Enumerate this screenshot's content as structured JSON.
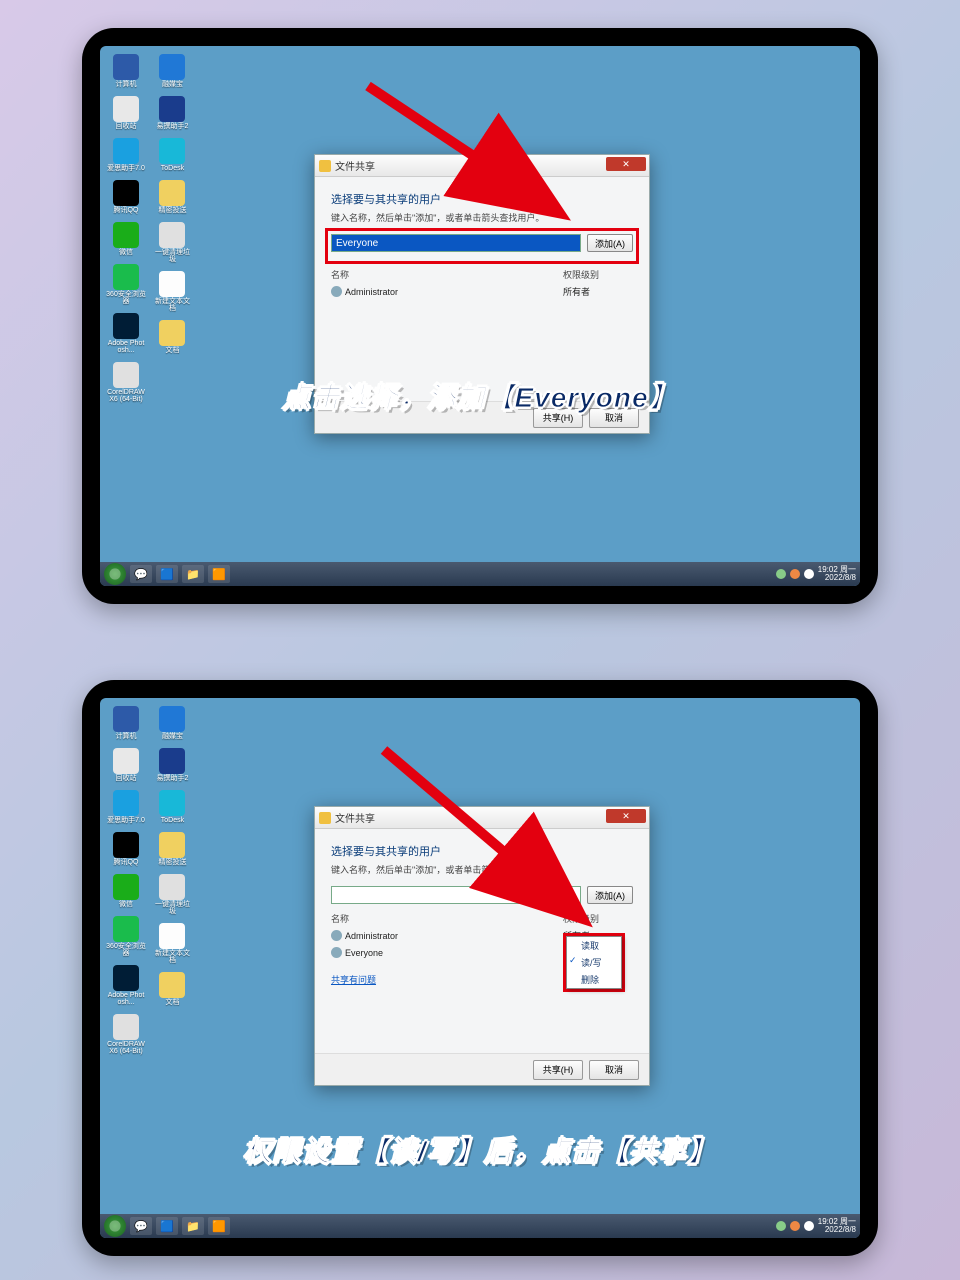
{
  "desktop_icons_col1": [
    {
      "label": "计算机",
      "bg": "#2d5aa8"
    },
    {
      "label": "回收站",
      "bg": "#e8e8e8"
    },
    {
      "label": "爱思助手7.0",
      "bg": "#1aa0e0"
    },
    {
      "label": "腾讯QQ",
      "bg": "#000"
    },
    {
      "label": "微信",
      "bg": "#1aad19"
    },
    {
      "label": "360安全浏览器",
      "bg": "#1abc4c"
    },
    {
      "label": "Adobe Photosh...",
      "bg": "#001d36"
    },
    {
      "label": "CorelDRAW X6 (64-Bit)",
      "bg": "#e0e0e0"
    }
  ],
  "desktop_icons_col2": [
    {
      "label": "融媒宝",
      "bg": "#2078d6"
    },
    {
      "label": "易撰助手2",
      "bg": "#1a3c8c"
    },
    {
      "label": "ToDesk",
      "bg": "#18b8d8"
    },
    {
      "label": "精密投送",
      "bg": "#f0d060"
    },
    {
      "label": "一键清理垃圾",
      "bg": "#e0e0e0"
    },
    {
      "label": "新建文本文档",
      "bg": "#fdfdfd"
    },
    {
      "label": "文档",
      "bg": "#f0d060"
    }
  ],
  "dialog": {
    "title": "文件共享",
    "subtitle": "选择要与其共享的用户",
    "hint": "键入名称，然后单击\"添加\"，或者单击箭头查找用户。",
    "combo_value": "Everyone",
    "add_btn": "添加(A)",
    "col_name": "名称",
    "col_perm": "权限级别",
    "rows1": [
      {
        "name": "Administrator",
        "perm": "所有者"
      }
    ],
    "rows2": [
      {
        "name": "Administrator",
        "perm": "所有者"
      },
      {
        "name": "Everyone",
        "perm": "读取/写入 ▼"
      }
    ],
    "perm_menu": [
      "读取",
      "读/写",
      "删除"
    ],
    "link": "共享有问题",
    "share_btn": "共享(H)",
    "cancel_btn": "取消"
  },
  "captions": {
    "top": "点击选择，添加【Everyone】",
    "bottom": "权限设置【读/写】后，点击【共享】"
  },
  "taskbar": {
    "time": "19:02 周一",
    "date": "2022/8/8"
  }
}
